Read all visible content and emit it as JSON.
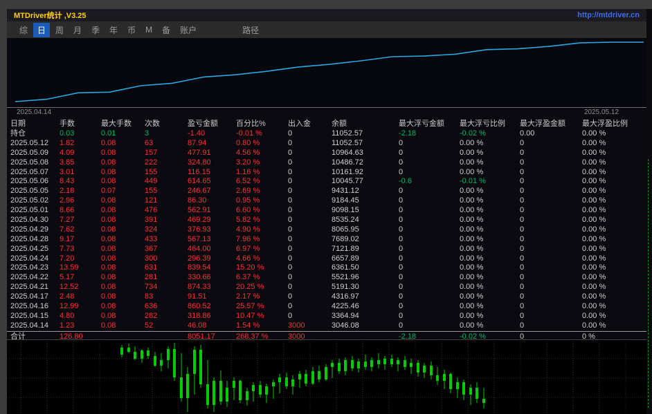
{
  "panel": {
    "title": "MTDriver统计 ,V3.25",
    "url": "http://mtdriver.cn"
  },
  "menu": {
    "items": [
      "综",
      "日",
      "周",
      "月",
      "季",
      "年",
      "币",
      "M",
      "备",
      "账户"
    ],
    "active_index": 1,
    "path_label": "路径"
  },
  "equity_chart": {
    "start_date": "2025.04.14",
    "end_date": "2025.05.12",
    "line_color": "#2ba8e0",
    "balances": [
      3046.08,
      3364.94,
      4225.46,
      4316.97,
      5191.3,
      5521.96,
      6361.5,
      6657.89,
      7121.89,
      7689.02,
      8065.95,
      8535.24,
      9098.15,
      9184.45,
      9431.12,
      10045.77,
      10161.92,
      10486.72,
      10964.63,
      11052.57,
      11052.57
    ]
  },
  "colors": {
    "red": "#ff3232",
    "green": "#00b865",
    "text": "#d0d0d0",
    "header": "#c9c9c9",
    "accent_blue": "#1b5cb8",
    "title_yellow": "#ffd200",
    "url_blue": "#3f6cf0",
    "candle_green": "#00cc00"
  },
  "table": {
    "headers": [
      "日期",
      "手数",
      "最大手数",
      "次数",
      "盈亏金额",
      "百分比%",
      "出入金",
      "余额",
      "最大浮亏金额",
      "最大浮亏比例",
      "最大浮盈金额",
      "最大浮盈比例"
    ],
    "position_row": {
      "label": "持仓",
      "values": [
        "0.03",
        "0.01",
        "3",
        "-1.40",
        "-0.01 %",
        "0",
        "11052.57",
        "-2.18",
        "-0.02 %",
        "0.00",
        "0.00 %"
      ]
    },
    "rows": [
      {
        "date": "2025.05.12",
        "values": [
          "1.82",
          "0.08",
          "63",
          "87.94",
          "0.80 %",
          "0",
          "11052.57",
          "0",
          "0.00 %",
          "0",
          "0.00 %"
        ]
      },
      {
        "date": "2025.05.09",
        "values": [
          "4.09",
          "0.08",
          "157",
          "477.91",
          "4.56 %",
          "0",
          "10964.63",
          "0",
          "0.00 %",
          "0",
          "0.00 %"
        ]
      },
      {
        "date": "2025.05.08",
        "values": [
          "3.85",
          "0.08",
          "222",
          "324.80",
          "3.20 %",
          "0",
          "10486.72",
          "0",
          "0.00 %",
          "0",
          "0.00 %"
        ]
      },
      {
        "date": "2025.05.07",
        "values": [
          "3.01",
          "0.08",
          "155",
          "116.15",
          "1.16 %",
          "0",
          "10161.92",
          "0",
          "0.00 %",
          "0",
          "0.00 %"
        ]
      },
      {
        "date": "2025.05.06",
        "values": [
          "8.43",
          "0.08",
          "449",
          "614.65",
          "6.52 %",
          "0",
          "10045.77",
          "-0.6",
          "-0.01 %",
          "0",
          "0.00 %"
        ]
      },
      {
        "date": "2025.05.05",
        "values": [
          "2.18",
          "0.07",
          "155",
          "246.67",
          "2.69 %",
          "0",
          "9431.12",
          "0",
          "0.00 %",
          "0",
          "0.00 %"
        ]
      },
      {
        "date": "2025.05.02",
        "values": [
          "2.96",
          "0.08",
          "121",
          "86.30",
          "0.95 %",
          "0",
          "9184.45",
          "0",
          "0.00 %",
          "0",
          "0.00 %"
        ]
      },
      {
        "date": "2025.05.01",
        "values": [
          "8.66",
          "0.08",
          "476",
          "562.91",
          "6.60 %",
          "0",
          "9098.15",
          "0",
          "0.00 %",
          "0",
          "0.00 %"
        ]
      },
      {
        "date": "2025.04.30",
        "values": [
          "7.27",
          "0.08",
          "391",
          "469.29",
          "5.82 %",
          "0",
          "8535.24",
          "0",
          "0.00 %",
          "0",
          "0.00 %"
        ]
      },
      {
        "date": "2025.04.29",
        "values": [
          "7.62",
          "0.08",
          "324",
          "376.93",
          "4.90 %",
          "0",
          "8065.95",
          "0",
          "0.00 %",
          "0",
          "0.00 %"
        ]
      },
      {
        "date": "2025.04.28",
        "values": [
          "9.17",
          "0.08",
          "433",
          "567.13",
          "7.96 %",
          "0",
          "7689.02",
          "0",
          "0.00 %",
          "0",
          "0.00 %"
        ]
      },
      {
        "date": "2025.04.25",
        "values": [
          "7.73",
          "0.08",
          "367",
          "464.00",
          "6.97 %",
          "0",
          "7121.89",
          "0",
          "0.00 %",
          "0",
          "0.00 %"
        ]
      },
      {
        "date": "2025.04.24",
        "values": [
          "7.20",
          "0.08",
          "300",
          "296.39",
          "4.66 %",
          "0",
          "6657.89",
          "0",
          "0.00 %",
          "0",
          "0.00 %"
        ]
      },
      {
        "date": "2025.04.23",
        "values": [
          "13.59",
          "0.08",
          "631",
          "839.54",
          "15.20 %",
          "0",
          "6361.50",
          "0",
          "0.00 %",
          "0",
          "0.00 %"
        ]
      },
      {
        "date": "2025.04.22",
        "values": [
          "5.17",
          "0.08",
          "281",
          "330.66",
          "6.37 %",
          "0",
          "5521.96",
          "0",
          "0.00 %",
          "0",
          "0.00 %"
        ]
      },
      {
        "date": "2025.04.21",
        "values": [
          "12.52",
          "0.08",
          "734",
          "874.33",
          "20.25 %",
          "0",
          "5191.30",
          "0",
          "0.00 %",
          "0",
          "0.00 %"
        ]
      },
      {
        "date": "2025.04.17",
        "values": [
          "2.48",
          "0.08",
          "83",
          "91.51",
          "2.17 %",
          "0",
          "4316.97",
          "0",
          "0.00 %",
          "0",
          "0.00 %"
        ]
      },
      {
        "date": "2025.04.16",
        "values": [
          "12.99",
          "0.08",
          "636",
          "860.52",
          "25.57 %",
          "0",
          "4225.46",
          "0",
          "0.00 %",
          "0",
          "0.00 %"
        ]
      },
      {
        "date": "2025.04.15",
        "values": [
          "4.80",
          "0.08",
          "282",
          "318.86",
          "10.47 %",
          "0",
          "3364.94",
          "0",
          "0.00 %",
          "0",
          "0.00 %"
        ]
      },
      {
        "date": "2025.04.14",
        "values": [
          "1.23",
          "0.08",
          "52",
          "46.08",
          "1.54 %",
          "3000",
          "3046.08",
          "0",
          "0.00 %",
          "0",
          "0.00 %"
        ]
      }
    ],
    "total_row": {
      "label": "合计",
      "values": [
        "126.80",
        "",
        "",
        "8051.17",
        "268.37 %",
        "3000",
        "",
        "-2.18",
        "-0.02 %",
        "0",
        "0 %"
      ]
    }
  },
  "candle_chart": {
    "candles": [
      [
        166,
        8,
        26,
        22,
        12
      ],
      [
        176,
        6,
        20,
        12,
        18
      ],
      [
        185,
        10,
        30,
        18,
        28
      ],
      [
        195,
        14,
        34,
        28,
        16
      ],
      [
        204,
        12,
        28,
        16,
        24
      ],
      [
        214,
        18,
        40,
        24,
        38
      ],
      [
        223,
        20,
        46,
        38,
        30
      ],
      [
        233,
        10,
        42,
        30,
        14
      ],
      [
        242,
        5,
        60,
        14,
        55
      ],
      [
        252,
        20,
        90,
        55,
        85
      ],
      [
        261,
        40,
        105,
        85,
        50
      ],
      [
        271,
        10,
        80,
        50,
        15
      ],
      [
        280,
        8,
        70,
        15,
        65
      ],
      [
        290,
        30,
        100,
        65,
        95
      ],
      [
        299,
        55,
        105,
        95,
        60
      ],
      [
        309,
        45,
        95,
        60,
        90
      ],
      [
        318,
        60,
        98,
        90,
        70
      ],
      [
        328,
        55,
        88,
        70,
        60
      ],
      [
        337,
        58,
        92,
        60,
        88
      ],
      [
        347,
        70,
        96,
        88,
        75
      ],
      [
        356,
        62,
        90,
        75,
        66
      ],
      [
        366,
        60,
        84,
        66,
        80
      ],
      [
        375,
        64,
        92,
        80,
        68
      ],
      [
        385,
        58,
        86,
        68,
        62
      ],
      [
        394,
        50,
        78,
        62,
        55
      ],
      [
        404,
        48,
        72,
        55,
        68
      ],
      [
        413,
        52,
        80,
        68,
        58
      ],
      [
        423,
        46,
        70,
        58,
        50
      ],
      [
        432,
        44,
        68,
        50,
        64
      ],
      [
        442,
        40,
        66,
        64,
        46
      ],
      [
        451,
        38,
        62,
        46,
        58
      ],
      [
        461,
        36,
        60,
        58,
        40
      ],
      [
        470,
        30,
        56,
        40,
        34
      ],
      [
        480,
        28,
        50,
        34,
        46
      ],
      [
        489,
        26,
        52,
        46,
        30
      ],
      [
        499,
        24,
        46,
        30,
        42
      ],
      [
        508,
        28,
        48,
        42,
        32
      ],
      [
        518,
        22,
        44,
        32,
        40
      ],
      [
        527,
        26,
        46,
        40,
        30
      ],
      [
        537,
        20,
        42,
        30,
        36
      ],
      [
        546,
        24,
        44,
        36,
        28
      ],
      [
        556,
        22,
        40,
        28,
        36
      ],
      [
        565,
        26,
        46,
        36,
        30
      ],
      [
        575,
        24,
        44,
        30,
        40
      ],
      [
        584,
        28,
        50,
        40,
        34
      ],
      [
        594,
        30,
        54,
        34,
        48
      ],
      [
        603,
        34,
        56,
        48,
        38
      ],
      [
        613,
        32,
        58,
        38,
        52
      ],
      [
        622,
        40,
        66,
        52,
        60
      ],
      [
        632,
        44,
        72,
        60,
        50
      ],
      [
        641,
        48,
        78,
        50,
        72
      ],
      [
        651,
        55,
        85,
        72,
        62
      ],
      [
        660,
        58,
        88,
        62,
        80
      ],
      [
        670,
        65,
        95,
        80,
        70
      ],
      [
        679,
        62,
        92,
        70,
        86
      ],
      [
        689,
        70,
        100,
        86,
        92
      ]
    ]
  }
}
